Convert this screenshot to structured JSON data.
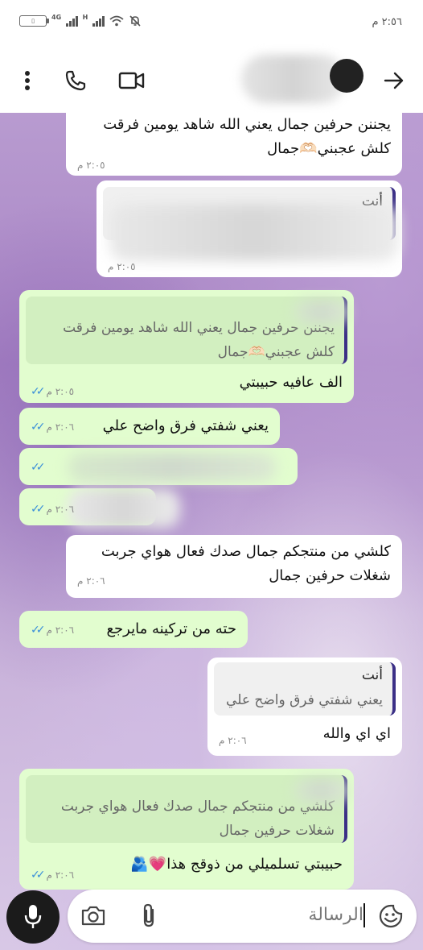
{
  "status_bar": {
    "time": "٢:٥٦ م",
    "network_label": "4G",
    "hspa_label": "H",
    "battery_label": "▯"
  },
  "header": {
    "contact_name": "",
    "icons": [
      "back-arrow-icon",
      "avatar",
      "video-call-icon",
      "voice-call-icon",
      "more-options-icon"
    ]
  },
  "messages": [
    {
      "id": "m1",
      "direction": "incoming",
      "text_lines": [
        "يجننن حرفين جمال يعني الله شاهد يومين فرقت",
        "كلش عجبني🫶🏻جمال"
      ],
      "time": "٢:٠٥ م"
    },
    {
      "id": "m2",
      "direction": "incoming",
      "quote_author": "أنت",
      "quote_text": "",
      "blurred": true,
      "time": "٢:٠٥ م"
    },
    {
      "id": "m3",
      "direction": "outgoing",
      "quote_text_lines": [
        "يجننن حرفين جمال يعني الله شاهد يومين فرقت",
        "كلش عجبني🫶🏻جمال"
      ],
      "text": "الف عافيه حبيبتي",
      "time": "٢:٠٥ م",
      "read": true
    },
    {
      "id": "m4",
      "direction": "outgoing",
      "text": "يعني شفتي فرق واضح علي",
      "time": "٢:٠٦ م",
      "read": true
    },
    {
      "id": "m5",
      "direction": "outgoing",
      "blurred": true,
      "read": true
    },
    {
      "id": "m6",
      "direction": "outgoing",
      "blurred": true,
      "time": "٢:٠٦ م",
      "read": true
    },
    {
      "id": "m7",
      "direction": "incoming",
      "text_lines": [
        "كلشي من منتجكم جمال صدك فعال هواي جربت",
        "شغلات حرفين جمال"
      ],
      "time": "٢:٠٦ م"
    },
    {
      "id": "m8",
      "direction": "outgoing",
      "text": "حته من تركينه مايرجع",
      "time": "٢:٠٦ م",
      "read": true
    },
    {
      "id": "m9",
      "direction": "incoming",
      "quote_author": "أنت",
      "quote_text": "يعني شفتي فرق واضح علي",
      "text": "اي اي والله",
      "time": "٢:٠٦ م"
    },
    {
      "id": "m10",
      "direction": "outgoing",
      "quote_text_lines": [
        "كلشي من منتجكم جمال صدك فعال هواي جربت",
        "شغلات حرفين جمال"
      ],
      "text": "حبيبتي تسلميلي من ذوقج هذا💗🫂",
      "time": "٢:٠٦ م",
      "read": true
    }
  ],
  "composer": {
    "placeholder": "الرسالة",
    "icons": [
      "mic-icon",
      "camera-icon",
      "attach-icon",
      "emoji-icon"
    ]
  },
  "colors": {
    "incoming_bubble": "#ffffff",
    "outgoing_bubble": "#e2fdcf",
    "read_ticks": "#3a8fd9",
    "quote_bar": "#3b2f86"
  }
}
